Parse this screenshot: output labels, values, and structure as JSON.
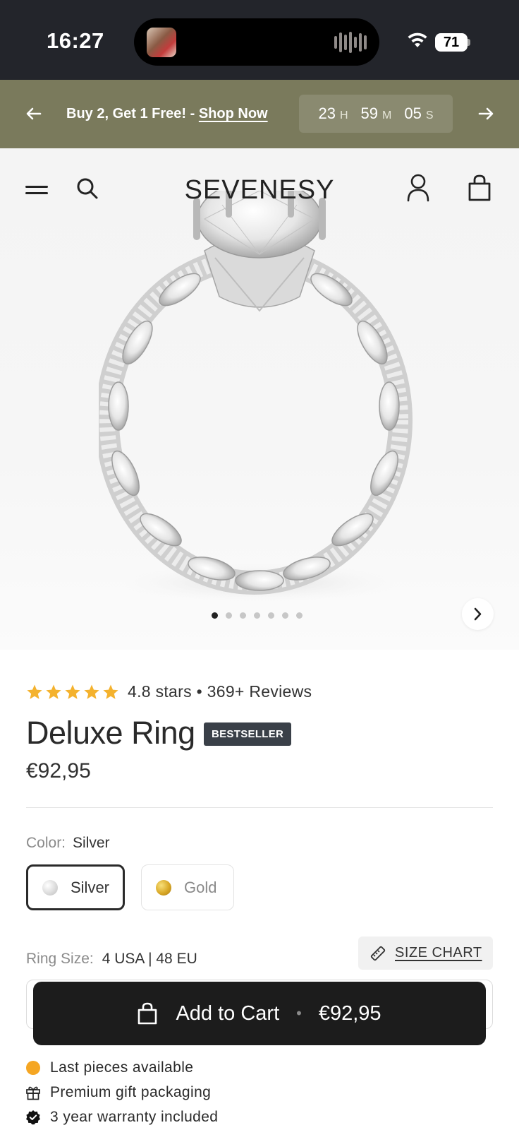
{
  "status_bar": {
    "time": "16:27",
    "battery": "71"
  },
  "promo": {
    "text": "Buy 2, Get 1 Free! - ",
    "link": "Shop Now",
    "countdown": [
      {
        "value": "23",
        "unit": "H"
      },
      {
        "value": "59",
        "unit": "M"
      },
      {
        "value": "05",
        "unit": "S"
      }
    ]
  },
  "header": {
    "brand": "SEVENESY"
  },
  "carousel": {
    "total_slides": 7,
    "active_index": 0
  },
  "product": {
    "rating_value": 4.8,
    "rating_text": "4.8 stars • 369+ Reviews",
    "title": "Deluxe Ring",
    "badge": "BESTSELLER",
    "price": "€92,95"
  },
  "color": {
    "label": "Color:",
    "selected": "Silver",
    "options": [
      {
        "name": "Silver",
        "color": "#d6d6d6"
      },
      {
        "name": "Gold",
        "color": "#d9a826"
      }
    ]
  },
  "size": {
    "label": "Ring Size:",
    "selected": "4 USA | 48 EU",
    "chart_label": "SIZE CHART"
  },
  "cart": {
    "label": "Add to Cart",
    "separator": "•",
    "price": "€92,95"
  },
  "perks": [
    {
      "icon": "orange-dot-icon",
      "text": "Last pieces available"
    },
    {
      "icon": "gift-icon",
      "text": "Premium gift packaging"
    },
    {
      "icon": "verified-badge-icon",
      "text": "3 year warranty included"
    }
  ],
  "colors": {
    "promo_bg": "#7a7a5c",
    "star": "#f4b22e",
    "button_bg": "#1c1c1c",
    "badge_bg": "#3a4048"
  }
}
